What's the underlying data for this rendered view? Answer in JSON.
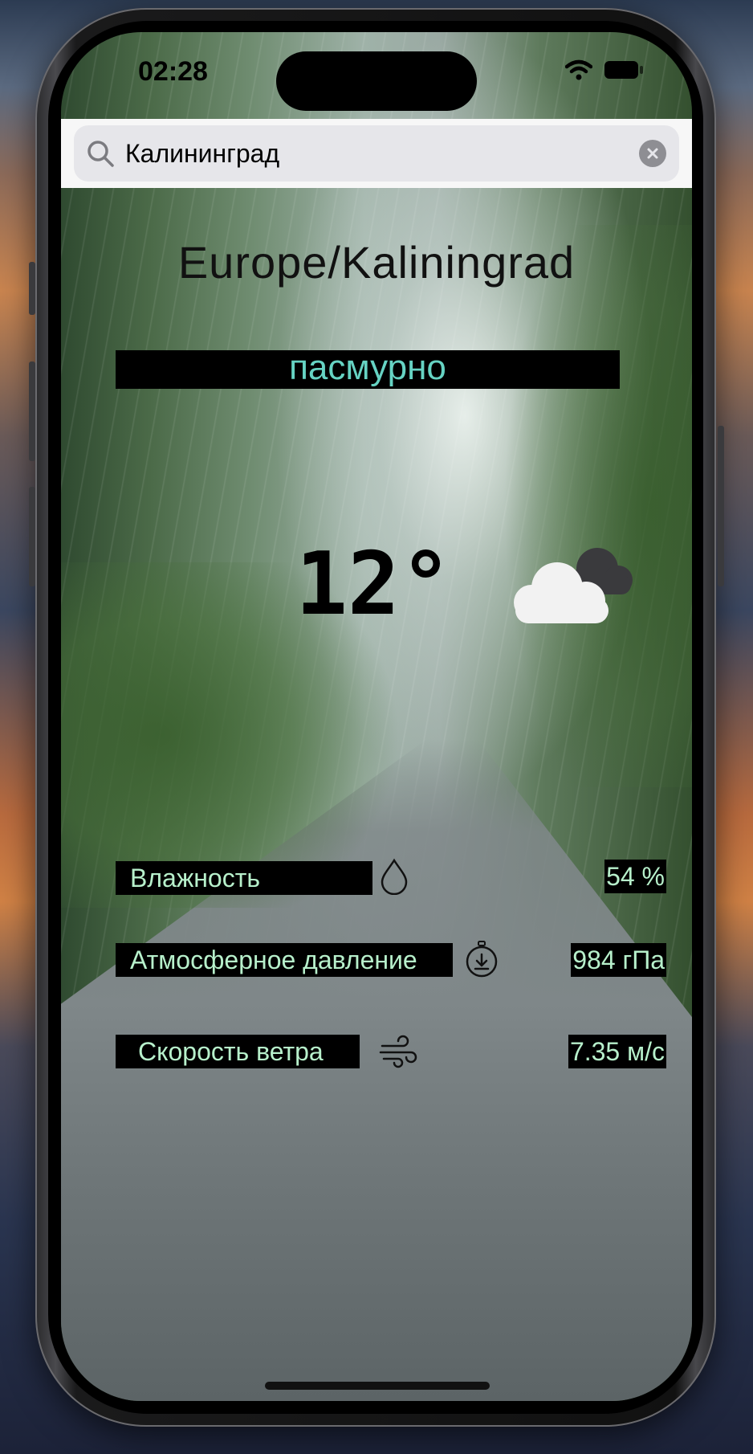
{
  "status_bar": {
    "time": "02:28",
    "icons": [
      "wifi-icon",
      "battery-icon"
    ]
  },
  "search": {
    "value": "Калининград",
    "icon": "search-icon",
    "clear_icon": "clear-icon"
  },
  "weather": {
    "timezone": "Europe/Kaliningrad",
    "condition": "пасмурно",
    "temperature": "12°",
    "condition_icon": "cloudy-icon"
  },
  "details": [
    {
      "label": "Влажность",
      "value": "54 %",
      "icon": "humidity-drop-icon"
    },
    {
      "label": "Атмосферное давление",
      "value": "984 гПа",
      "icon": "pressure-gauge-icon"
    },
    {
      "label": "Скорость ветра",
      "value": "7.35 м/с",
      "icon": "wind-icon"
    }
  ],
  "colors": {
    "label_text": "#b7f0cb",
    "condition_text": "#66d3c3",
    "label_background": "#000000"
  }
}
